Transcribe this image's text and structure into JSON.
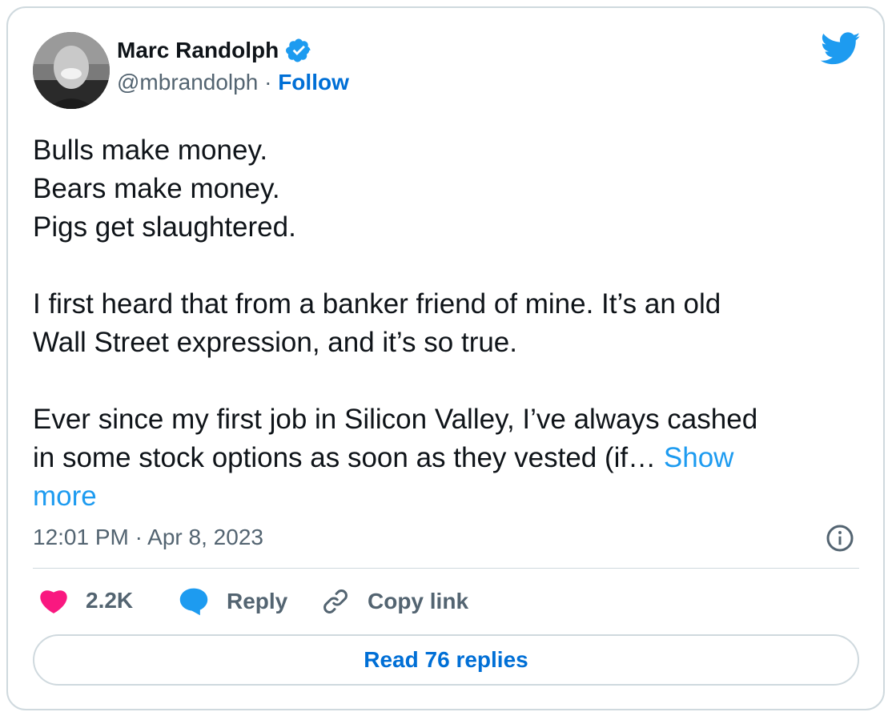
{
  "author": {
    "name": "Marc Randolph",
    "handle": "@mbrandolph",
    "separator": "·",
    "follow_label": "Follow"
  },
  "tweet": {
    "lines": [
      "Bulls make money.",
      "Bears make money.",
      "Pigs get slaughtered.",
      "",
      "I first heard that from a banker friend of mine. It’s an old",
      "Wall Street expression, and it’s so true.",
      "",
      "Ever since my first job in Silicon Valley, I’ve always cashed",
      "in some stock options as soon as they vested (if… "
    ],
    "show_more_a": "Show",
    "show_more_b": "more",
    "timestamp": "12:01 PM · Apr 8, 2023"
  },
  "actions": {
    "like_count": "2.2K",
    "reply_label": "Reply",
    "copy_label": "Copy link"
  },
  "footer": {
    "read_replies_label": "Read 76 replies"
  },
  "colors": {
    "link": "#006fd6",
    "twitter_blue": "#1d9bf0",
    "like": "#f91880",
    "muted": "#536471",
    "border": "#cfd9de"
  },
  "icons": [
    "verified-badge-icon",
    "twitter-bird-icon",
    "info-icon",
    "heart-icon",
    "reply-bubble-icon",
    "link-icon"
  ]
}
